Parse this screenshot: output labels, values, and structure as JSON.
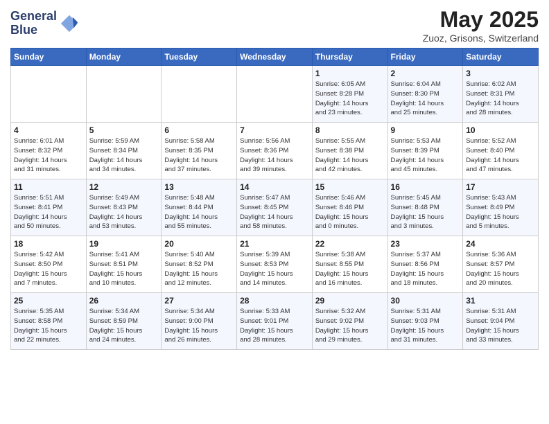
{
  "header": {
    "logo_line1": "General",
    "logo_line2": "Blue",
    "month_year": "May 2025",
    "location": "Zuoz, Grisons, Switzerland"
  },
  "weekdays": [
    "Sunday",
    "Monday",
    "Tuesday",
    "Wednesday",
    "Thursday",
    "Friday",
    "Saturday"
  ],
  "weeks": [
    [
      {
        "day": "",
        "text": ""
      },
      {
        "day": "",
        "text": ""
      },
      {
        "day": "",
        "text": ""
      },
      {
        "day": "",
        "text": ""
      },
      {
        "day": "1",
        "text": "Sunrise: 6:05 AM\nSunset: 8:28 PM\nDaylight: 14 hours\nand 23 minutes."
      },
      {
        "day": "2",
        "text": "Sunrise: 6:04 AM\nSunset: 8:30 PM\nDaylight: 14 hours\nand 25 minutes."
      },
      {
        "day": "3",
        "text": "Sunrise: 6:02 AM\nSunset: 8:31 PM\nDaylight: 14 hours\nand 28 minutes."
      }
    ],
    [
      {
        "day": "4",
        "text": "Sunrise: 6:01 AM\nSunset: 8:32 PM\nDaylight: 14 hours\nand 31 minutes."
      },
      {
        "day": "5",
        "text": "Sunrise: 5:59 AM\nSunset: 8:34 PM\nDaylight: 14 hours\nand 34 minutes."
      },
      {
        "day": "6",
        "text": "Sunrise: 5:58 AM\nSunset: 8:35 PM\nDaylight: 14 hours\nand 37 minutes."
      },
      {
        "day": "7",
        "text": "Sunrise: 5:56 AM\nSunset: 8:36 PM\nDaylight: 14 hours\nand 39 minutes."
      },
      {
        "day": "8",
        "text": "Sunrise: 5:55 AM\nSunset: 8:38 PM\nDaylight: 14 hours\nand 42 minutes."
      },
      {
        "day": "9",
        "text": "Sunrise: 5:53 AM\nSunset: 8:39 PM\nDaylight: 14 hours\nand 45 minutes."
      },
      {
        "day": "10",
        "text": "Sunrise: 5:52 AM\nSunset: 8:40 PM\nDaylight: 14 hours\nand 47 minutes."
      }
    ],
    [
      {
        "day": "11",
        "text": "Sunrise: 5:51 AM\nSunset: 8:41 PM\nDaylight: 14 hours\nand 50 minutes."
      },
      {
        "day": "12",
        "text": "Sunrise: 5:49 AM\nSunset: 8:43 PM\nDaylight: 14 hours\nand 53 minutes."
      },
      {
        "day": "13",
        "text": "Sunrise: 5:48 AM\nSunset: 8:44 PM\nDaylight: 14 hours\nand 55 minutes."
      },
      {
        "day": "14",
        "text": "Sunrise: 5:47 AM\nSunset: 8:45 PM\nDaylight: 14 hours\nand 58 minutes."
      },
      {
        "day": "15",
        "text": "Sunrise: 5:46 AM\nSunset: 8:46 PM\nDaylight: 15 hours\nand 0 minutes."
      },
      {
        "day": "16",
        "text": "Sunrise: 5:45 AM\nSunset: 8:48 PM\nDaylight: 15 hours\nand 3 minutes."
      },
      {
        "day": "17",
        "text": "Sunrise: 5:43 AM\nSunset: 8:49 PM\nDaylight: 15 hours\nand 5 minutes."
      }
    ],
    [
      {
        "day": "18",
        "text": "Sunrise: 5:42 AM\nSunset: 8:50 PM\nDaylight: 15 hours\nand 7 minutes."
      },
      {
        "day": "19",
        "text": "Sunrise: 5:41 AM\nSunset: 8:51 PM\nDaylight: 15 hours\nand 10 minutes."
      },
      {
        "day": "20",
        "text": "Sunrise: 5:40 AM\nSunset: 8:52 PM\nDaylight: 15 hours\nand 12 minutes."
      },
      {
        "day": "21",
        "text": "Sunrise: 5:39 AM\nSunset: 8:53 PM\nDaylight: 15 hours\nand 14 minutes."
      },
      {
        "day": "22",
        "text": "Sunrise: 5:38 AM\nSunset: 8:55 PM\nDaylight: 15 hours\nand 16 minutes."
      },
      {
        "day": "23",
        "text": "Sunrise: 5:37 AM\nSunset: 8:56 PM\nDaylight: 15 hours\nand 18 minutes."
      },
      {
        "day": "24",
        "text": "Sunrise: 5:36 AM\nSunset: 8:57 PM\nDaylight: 15 hours\nand 20 minutes."
      }
    ],
    [
      {
        "day": "25",
        "text": "Sunrise: 5:35 AM\nSunset: 8:58 PM\nDaylight: 15 hours\nand 22 minutes."
      },
      {
        "day": "26",
        "text": "Sunrise: 5:34 AM\nSunset: 8:59 PM\nDaylight: 15 hours\nand 24 minutes."
      },
      {
        "day": "27",
        "text": "Sunrise: 5:34 AM\nSunset: 9:00 PM\nDaylight: 15 hours\nand 26 minutes."
      },
      {
        "day": "28",
        "text": "Sunrise: 5:33 AM\nSunset: 9:01 PM\nDaylight: 15 hours\nand 28 minutes."
      },
      {
        "day": "29",
        "text": "Sunrise: 5:32 AM\nSunset: 9:02 PM\nDaylight: 15 hours\nand 29 minutes."
      },
      {
        "day": "30",
        "text": "Sunrise: 5:31 AM\nSunset: 9:03 PM\nDaylight: 15 hours\nand 31 minutes."
      },
      {
        "day": "31",
        "text": "Sunrise: 5:31 AM\nSunset: 9:04 PM\nDaylight: 15 hours\nand 33 minutes."
      }
    ]
  ]
}
